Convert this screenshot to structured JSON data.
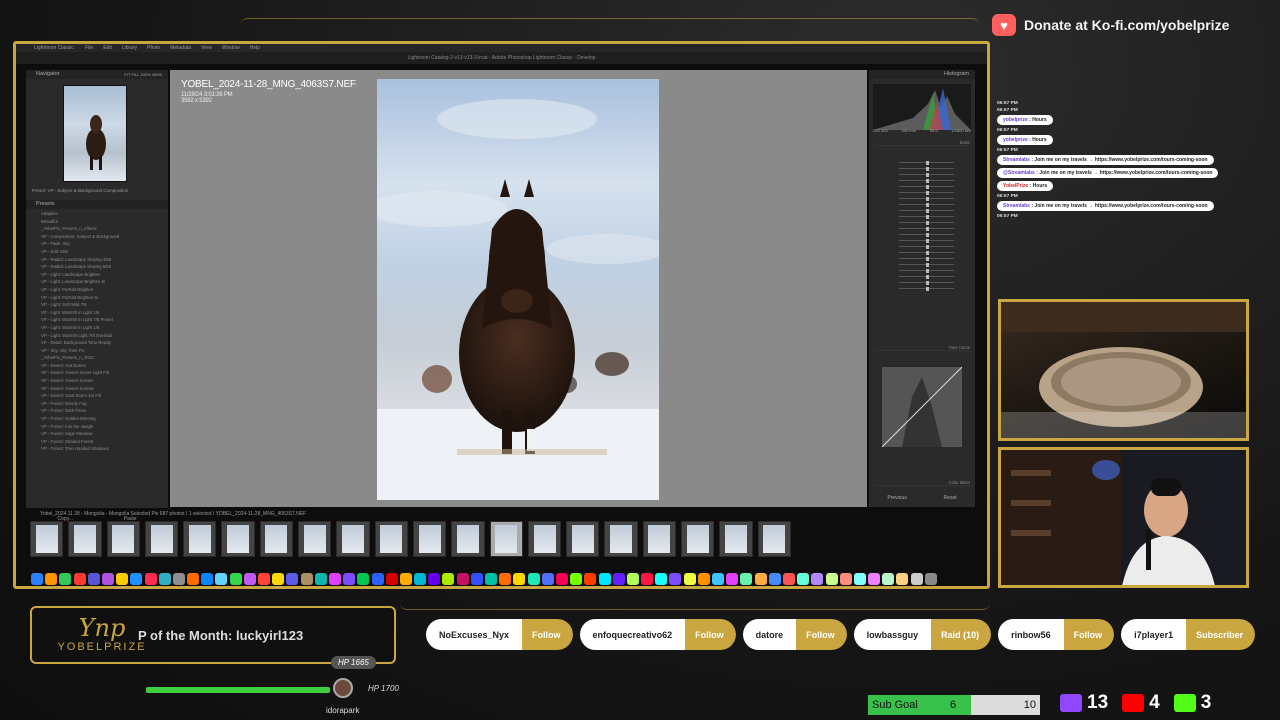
{
  "donate": {
    "text": "Donate at Ko-fi.com/yobelprize",
    "icon": "ko-fi-heart-icon"
  },
  "lightroom": {
    "app_menu": "Lightroom Classic",
    "menu_items": [
      "File",
      "Edit",
      "Library",
      "Photo",
      "Metadata",
      "View",
      "Window",
      "Help"
    ],
    "window_title": "Lightroom Catalog-2-v13-v13-3.lrcat - Adobe Photoshop Lightroom Classic - Develop",
    "navigator": {
      "label": "Navigator",
      "zoom": "FIT  FILL  100%  400%"
    },
    "preset_header": "Preset: VP - Subject & Background Composition",
    "presets_label": "Presets",
    "presets": [
      "Adaptive",
      "Beautiful",
      "_YobelPix_Presets_n_effects",
      "VP - Composition: Subject & Background",
      "VP - Fade: Sky",
      "VP - Edit: Mist",
      "VP - Radial: Landscape Sloping 4/50",
      "VP - Radial: Landscape Sloping 5/50",
      "VP - Light: Landscape Brighten",
      "VP - Light: Landscape Brighten 5/",
      "VP - Light: Portrait Brighten",
      "VP - Light: Portrait Brighten 5/",
      "VP - Light: Soft Wild 7/8",
      "VP - Light: Warmth in Light 1/8",
      "VP - Light: Warmth in Light 7/8 Preset",
      "VP - Light: Warmth in Light 1/8",
      "VP - Light: Warmth Light 7/8 Overlaid",
      "VP - Detail: Background Tone Ready",
      "VP - Sky: Sky Tone Fix",
      "_YobelPix_Presets_n_2012",
      "VP - Desert: Hot Dunes",
      "VP - Desert: Desert Scene Light Fill",
      "VP - Desert: Desert Sunset",
      "VP - Desert: Desert Sunrise",
      "VP - Desert: Dust Storm 4/4 Fill",
      "VP - Forest: Moody Fog",
      "VP - Forest: Dark Pines",
      "VP - Forest: Golden Morning",
      "VP - Forest: Into the Jungle",
      "VP - Forest: Sage Meadow",
      "VP - Forest: Shaded Forest",
      "VP - Forest: Tree Hooded Shadows"
    ],
    "copy_label": "Copy...",
    "paste_label": "Paste",
    "image": {
      "filename": "YOBEL_2024-11-28_MNG_4063S7.NEF",
      "datetime": "11/28/24 3:01:26 PM",
      "dimensions": "3592 x 5392"
    },
    "right_panel": {
      "histogram_label": "Histogram",
      "basic_label": "Basic",
      "tone_curve_label": "Tone Curve",
      "color_mixer_label": "Color Mixer",
      "histo_readout": [
        "ISO 400",
        "400 mm",
        "f/5.6",
        "1/1600 sec"
      ],
      "previous_label": "Previous",
      "reset_label": "Reset"
    },
    "filmstrip_info": "Yobel_2024 11 28 - Mongolia - Mongolia Selected Pix      687 photos / 1 selected / YOBEL_2024-11-28_MNG_4063S7.NEF",
    "filmstrip_count": 20
  },
  "chat": [
    {
      "time": "06:57 PM",
      "user": "",
      "msg": ""
    },
    {
      "time": "06:57 PM",
      "user": "yobelprize",
      "msg": "Hours"
    },
    {
      "time": "06:57 PM",
      "user": "yobelprize",
      "msg": "Hours"
    },
    {
      "time": "06:57 PM",
      "user": "Streamlabs",
      "msg": "Join me on my travels → https://www.yobelprize.com/tours-coming-soon"
    },
    {
      "time": "",
      "user": "@Streamlabs",
      "msg": "Join me on my travels → https://www.yobelprize.com/tours-coming-soon"
    },
    {
      "time": "",
      "user": "YobelPrize",
      "msg": "Hours"
    },
    {
      "time": "06:57 PM",
      "user": "Streamlabs",
      "msg": "Join me on my travels → https://www.yobelprize.com/tours-coming-soon"
    },
    {
      "time": "06:57 PM",
      "user": "",
      "msg": ""
    }
  ],
  "brand": {
    "mark": "Ynp",
    "word": "YOBELPRIZE"
  },
  "ticker": "P of the Month: luckyirl123",
  "hp": {
    "current": "HP 1665",
    "max": "HP 1700",
    "name": "idorapark",
    "fraction": 0.98
  },
  "events": [
    {
      "name": "NoExcuses_Nyx",
      "type": "Follow"
    },
    {
      "name": "enfoquecreativo62",
      "type": "Follow"
    },
    {
      "name": "datore",
      "type": "Follow"
    },
    {
      "name": "lowbassguy",
      "type": "Raid (10)"
    },
    {
      "name": "rinbow56",
      "type": "Follow"
    },
    {
      "name": "i7player1",
      "type": "Subscriber"
    }
  ],
  "subgoal": {
    "label": "Sub Goal",
    "current": "6",
    "target": "10",
    "fraction": 0.6
  },
  "counts": [
    {
      "icon": "twitch-icon",
      "value": "13",
      "color": "#9146ff"
    },
    {
      "icon": "youtube-icon",
      "value": "4",
      "color": "#ff0000"
    },
    {
      "icon": "kick-icon",
      "value": "3",
      "color": "#53fc18"
    }
  ],
  "colors": {
    "accent": "#c9a640",
    "hp_green": "#3ecf3e",
    "goal_green": "#38c24c"
  }
}
